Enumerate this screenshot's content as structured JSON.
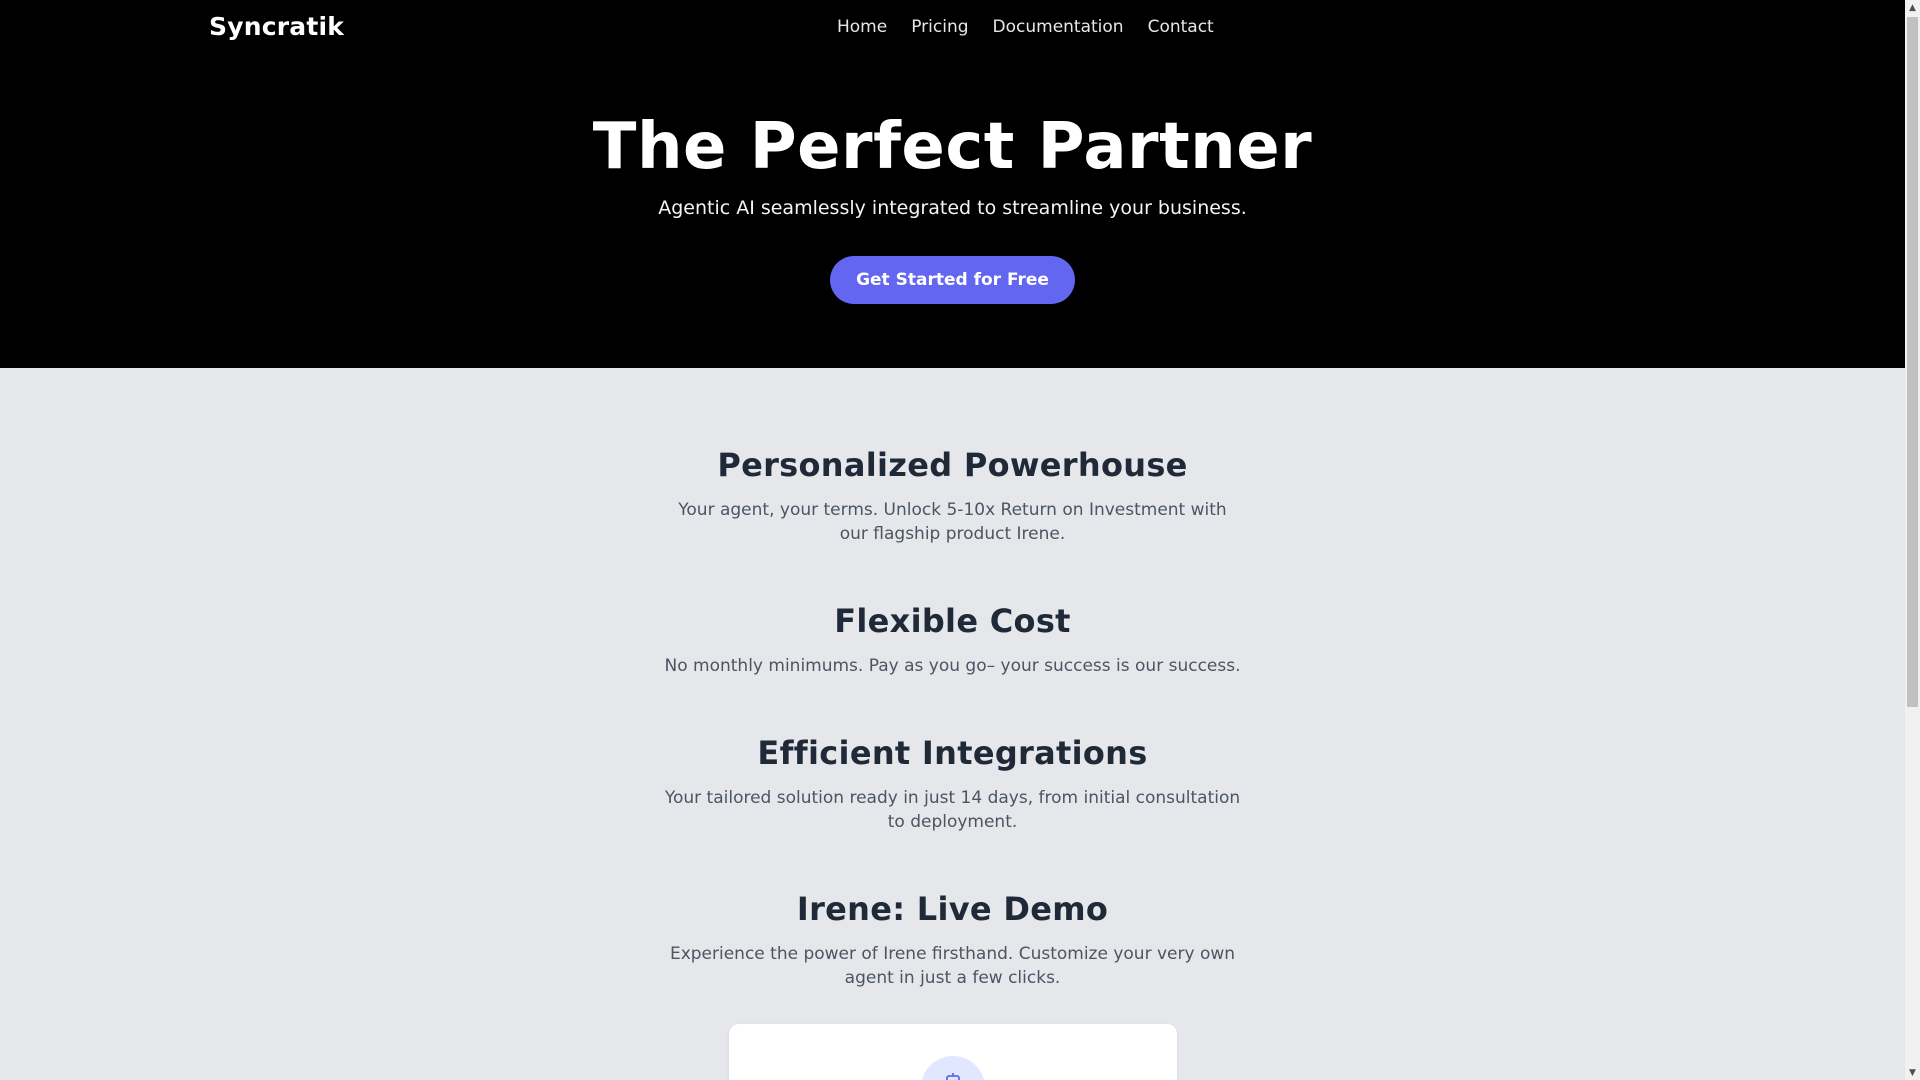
{
  "brand": "Syncratik",
  "nav": {
    "items": [
      "Home",
      "Pricing",
      "Documentation",
      "Contact"
    ]
  },
  "hero": {
    "title": "The Perfect Partner",
    "subtitle": "Agentic AI seamlessly integrated to streamline your business.",
    "cta_label": "Get Started for Free"
  },
  "features": [
    {
      "title": "Personalized Powerhouse",
      "text": "Your agent, your terms. Unlock 5-10x Return on Investment with our flagship product Irene."
    },
    {
      "title": "Flexible Cost",
      "text": "No monthly minimums. Pay as you go– your success is our success."
    },
    {
      "title": "Efficient Integrations",
      "text": "Your tailored solution ready in just 14 days, from initial consultation to deployment."
    },
    {
      "title": "Irene: Live Demo",
      "text": "Experience the power of Irene firsthand. Customize your very own agent in just a few clicks."
    }
  ],
  "colors": {
    "hero_bg": "#000000",
    "accent": "#6366f1",
    "page_bg": "#e5e7eb",
    "heading": "#1f2937",
    "body_text": "#4b5563"
  },
  "icons": {
    "demo_avatar": "robot-icon"
  }
}
